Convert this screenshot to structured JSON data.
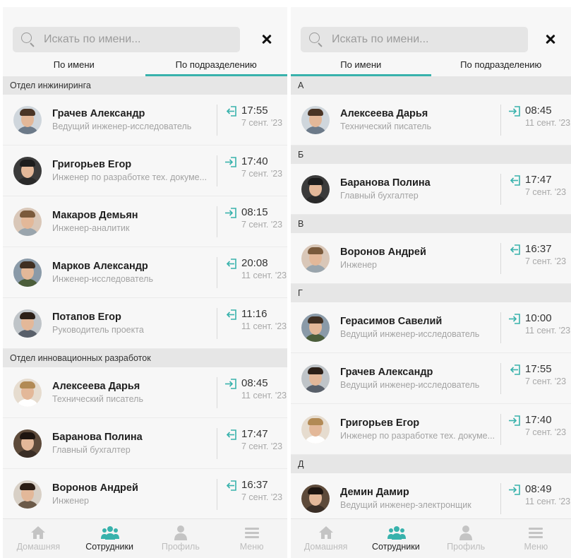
{
  "colors": {
    "accent": "#38b2ac",
    "entry": "#38b2ac",
    "inactive_nav": "#c4c4c4"
  },
  "search": {
    "placeholder": "Искать по имени..."
  },
  "tabs": {
    "by_name": "По имени",
    "by_department": "По подразделению"
  },
  "nav": {
    "home": "Домашняя",
    "employees": "Сотрудники",
    "profile": "Профиль",
    "menu": "Меню"
  },
  "left_screen": {
    "active_tab": "by_department",
    "sections": [
      {
        "title": "Отдел инжиниринга",
        "rows": [
          {
            "name": "Грачев  Александр",
            "position": "Ведущий инженер-исследователь",
            "direction": "out",
            "time": "17:55",
            "date": "7 сент. '23"
          },
          {
            "name": "Григорьев  Егор",
            "position": "Инженер по разработке тех. докуме...",
            "direction": "in",
            "time": "17:40",
            "date": "7 сент. '23"
          },
          {
            "name": "Макаров Демьян",
            "position": "Инженер-аналитик",
            "direction": "in",
            "time": "08:15",
            "date": "7 сент. '23"
          },
          {
            "name": "Марков Александр",
            "position": "Инженер-исследователь",
            "direction": "out",
            "time": "20:08",
            "date": "11 сент. '23"
          },
          {
            "name": "Потапов Егор",
            "position": "Руководитель проекта",
            "direction": "out",
            "time": "11:16",
            "date": "11 сент. '23"
          }
        ]
      },
      {
        "title": "Отдел инновационных разработок",
        "rows": [
          {
            "name": "Алексеева  Дарья",
            "position": "Технический писатель",
            "direction": "in",
            "time": "08:45",
            "date": "11 сент. '23"
          },
          {
            "name": "Баранова Полина",
            "position": "Главный бухгалтер",
            "direction": "out",
            "time": "17:47",
            "date": "7 сент. '23"
          },
          {
            "name": "Воронов  Андрей",
            "position": "Инженер",
            "direction": "out",
            "time": "16:37",
            "date": "7 сент. '23"
          }
        ]
      }
    ]
  },
  "right_screen": {
    "active_tab": "by_name",
    "sections": [
      {
        "title": "А",
        "rows": [
          {
            "name": "Алексеева  Дарья",
            "position": "Технический писатель",
            "direction": "in",
            "time": "08:45",
            "date": "11 сент. '23"
          }
        ]
      },
      {
        "title": "Б",
        "rows": [
          {
            "name": "Баранова Полина",
            "position": "Главный бухгалтер",
            "direction": "out",
            "time": "17:47",
            "date": "7 сент. '23"
          }
        ]
      },
      {
        "title": "В",
        "rows": [
          {
            "name": "Воронов  Андрей",
            "position": "Инженер",
            "direction": "out",
            "time": "16:37",
            "date": "7 сент. '23"
          }
        ]
      },
      {
        "title": "Г",
        "rows": [
          {
            "name": "Герасимов Савелий",
            "position": "Ведущий инженер-исследователь",
            "direction": "in",
            "time": "10:00",
            "date": "11 сент. '23"
          },
          {
            "name": "Грачев  Александр",
            "position": "Ведущий инженер-исследователь",
            "direction": "out",
            "time": "17:55",
            "date": "7 сент. '23"
          },
          {
            "name": "Григорьев  Егор",
            "position": "Инженер по разработке тех. докуме...",
            "direction": "in",
            "time": "17:40",
            "date": "7 сент. '23"
          }
        ]
      },
      {
        "title": "Д",
        "rows": [
          {
            "name": "Демин  Дамир",
            "position": "Ведущий инженер-электронщик",
            "direction": "in",
            "time": "08:49",
            "date": "11 сент. '23"
          }
        ]
      }
    ]
  }
}
